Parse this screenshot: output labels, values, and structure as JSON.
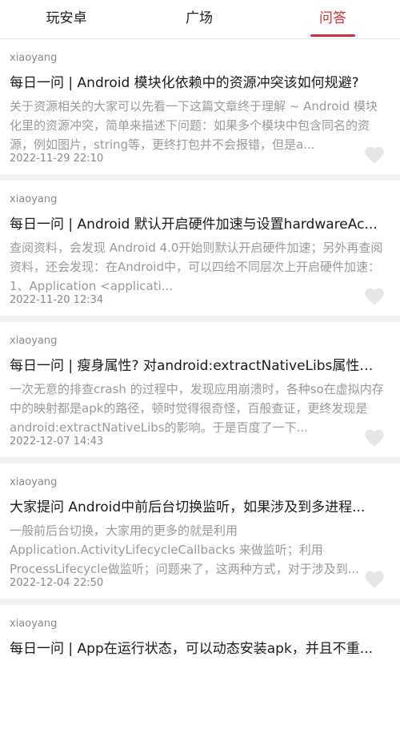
{
  "tabs": [
    {
      "label": "玩安卓"
    },
    {
      "label": "广场"
    },
    {
      "label": "问答"
    }
  ],
  "active_tab": 2,
  "items": [
    {
      "author": "xiaoyang",
      "title": "每日一问 | Android 模块化依赖中的资源冲突该如何规避?",
      "desc": "关于资源相关的大家可以先看一下这篇文章终于理解 ~ Android 模块化里的资源冲突，简单来描述下问题：如果多个模块中包含同名的资源，例如图片，string等，更终打包并不会报错，但是a...",
      "date": "2022-11-29 22:10"
    },
    {
      "author": "xiaoyang",
      "title": "每日一问 | Android 默认开启硬件加速与设置hardwareAc...",
      "desc": "查阅资料，会发现 Android 4.0开始则默认开启硬件加速；另外再查阅资料，还会发现：在Android中，可以四给不同层次上开启硬件加速：1、Application <applicati...",
      "date": "2022-11-20 12:34"
    },
    {
      "author": "xiaoyang",
      "title": "每日一问 | 瘦身属性? 对android:extractNativeLibs属性的...",
      "desc": "一次无意的排查crash 的过程中，发现应用崩溃时，各种so在虚拟内存中的映射都是apk的路径，顿时觉得很奇怪，百般查证，更终发现是android:extractNativeLibs的影响。于是百度了一下...",
      "date": "2022-12-07 14:43"
    },
    {
      "author": "xiaoyang",
      "title": "大家提问 Android中前后台切换监听，如果涉及到多进程...",
      "desc": "一般前后台切换，大家用的更多的就是利用 Application.ActivityLifecycleCallbacks 来做监听；利用 ProcessLifecycle做监听；问题来了，这两种方式，对于涉及到...",
      "date": "2022-12-04 22:50"
    },
    {
      "author": "xiaoyang",
      "title": "每日一问 | App在运行状态，可以动态安装apk，并且不重...",
      "desc": "",
      "date": ""
    }
  ],
  "like_icon": "heart-icon",
  "colors": {
    "accent": "#d0323b",
    "like": "#e6e6e6"
  }
}
